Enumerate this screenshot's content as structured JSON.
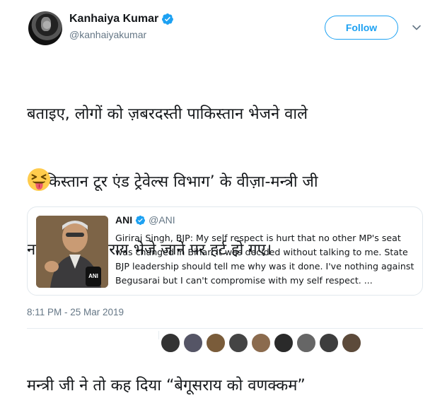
{
  "tweet": {
    "author_name": "Kanhaiya Kumar",
    "author_handle": "@kanhaiyakumar",
    "follow_label": "Follow",
    "text_lines": [
      "बताइए, लोगों को ज़बरदस्ती पाकिस्तान भेजने वाले",
      "‘पाकिस्तान टूर एंड ट्रेवेल्स विभाग’ के वीज़ा-मन्त्री जी",
      "नवादा से बेगूसराय भेजे जाने पर हर्ट हो गए।",
      "मन्त्री जी ने तो कह दिया “बेगूसराय को वणक्कम”"
    ],
    "timestamp": "8:11 PM - 25 Mar 2019"
  },
  "quoted": {
    "name": "ANI",
    "handle": "@ANI",
    "text": "Giriraj Singh, BJP: My self respect is hurt that no other MP's seat was changed in Bihar. It was decided without talking to me. State BJP leadership should tell me why was it done. I've nothing against Begusarai but I can't compromise with my self respect. ...",
    "image_label": "ANI"
  },
  "colors": {
    "accent": "#1da1f2",
    "secondary_text": "#657786",
    "border": "#e1e8ed"
  },
  "icons": {
    "verified": "verified-badge-icon",
    "caret": "chevron-down-icon",
    "emoji": "squinting-face-with-tongue-icon"
  }
}
